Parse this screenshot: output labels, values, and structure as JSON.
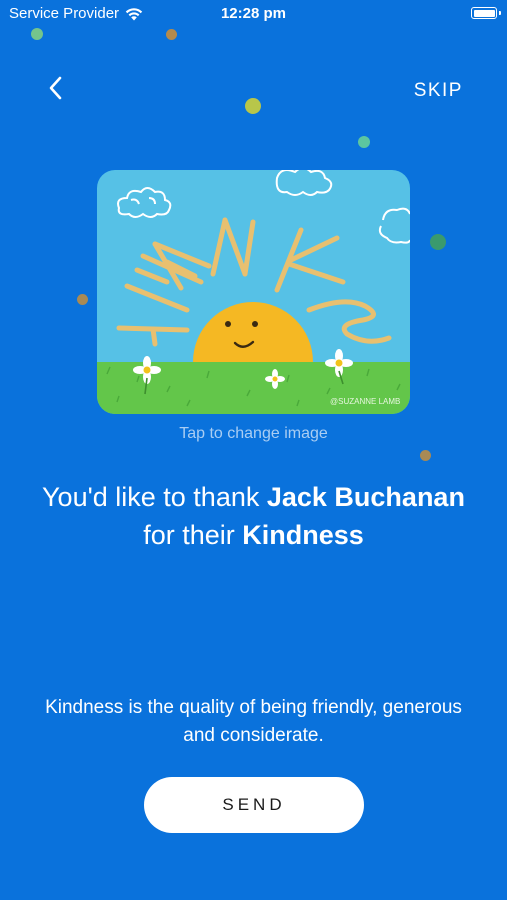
{
  "status_bar": {
    "carrier": "Service Provider",
    "time": "12:28 pm"
  },
  "header": {
    "back_icon": "chevron-left-icon",
    "skip_label": "SKIP"
  },
  "card": {
    "caption": "Tap to change image",
    "artwork_text": "THANKS",
    "artist_signature": "@SUZANNE LAMB"
  },
  "headline": {
    "part1": "You'd like to thank ",
    "recipient": "Jack Buchanan",
    "part2": " for their ",
    "value": "Kindness"
  },
  "description": "Kindness is the quality of being friendly, generous and considerate.",
  "send_label": "SEND",
  "colors": {
    "background": "#0a72dc",
    "button_bg": "#ffffff",
    "caption": "#a9cdf3"
  }
}
